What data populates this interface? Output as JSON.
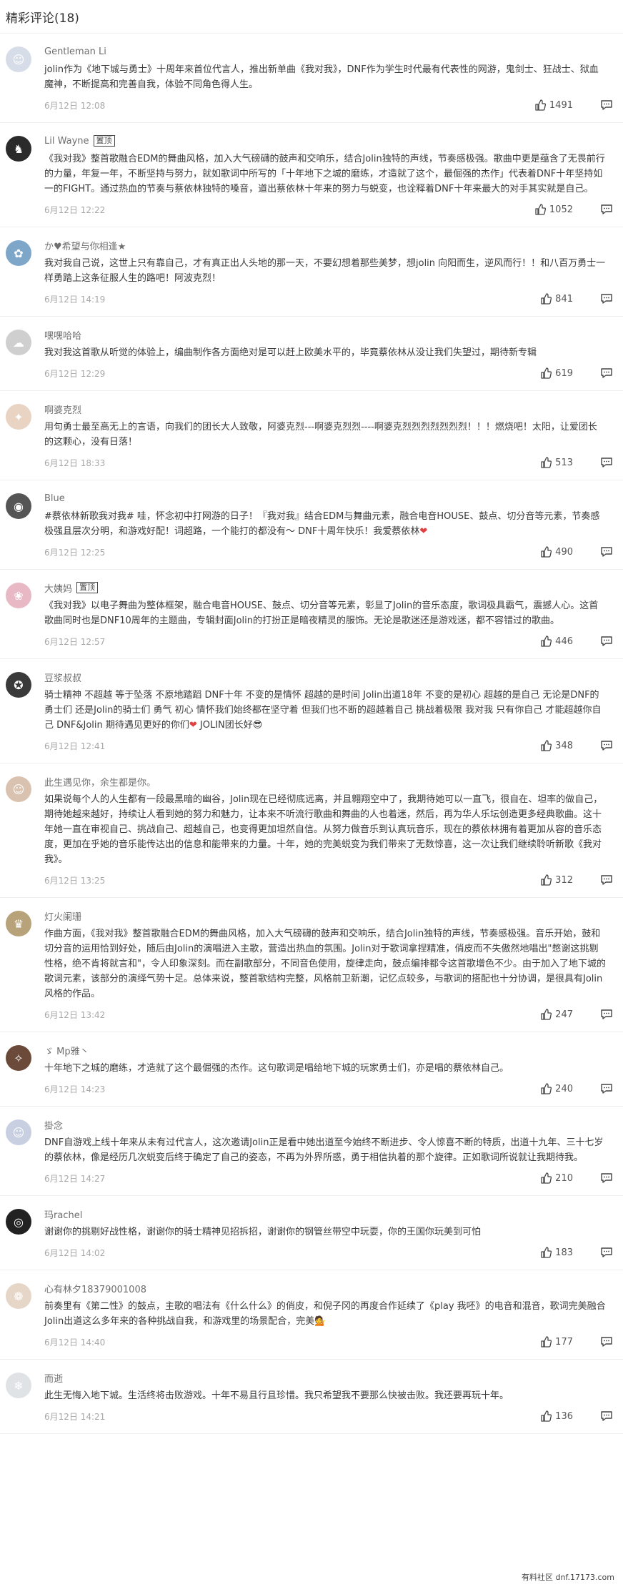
{
  "header": {
    "title": "精彩评论(18)"
  },
  "comments": [
    {
      "user": "Gentleman Li",
      "tag": "",
      "text": "jolin作为《地下城与勇士》十周年来首位代言人，推出新单曲《我对我》，DNF作为学生时代最有代表性的网游，鬼剑士、狂战士、狱血魔神，不断提高和完善自我，体验不同角色得人生。",
      "date": "6月12日 12:08",
      "likes": "1491",
      "avatar_color": "#d7dde8",
      "avatar_glyph": "☺"
    },
    {
      "user": "Lil Wayne",
      "tag": "置顶",
      "text": "《我对我》整首歌融合EDM的舞曲风格，加入大气磅礴的鼓声和交响乐，结合Jolin独特的声线，节奏感极强。歌曲中更是蕴含了无畏前行的力量，年复一年，不断坚持与努力，就如歌词中所写的「十年地下之城的磨练，才造就了这个，最倔强的杰作」代表着DNF十年坚持如一的FIGHT。通过热血的节奏与蔡依林独特的嗓音，道出蔡依林十年来的努力与蜕变，也诠释着DNF十年来最大的对手其实就是自己。",
      "date": "6月12日 12:22",
      "likes": "1052",
      "avatar_color": "#2b2b2b",
      "avatar_glyph": "♞"
    },
    {
      "user": "か♥希望与你相逢★",
      "tag": "",
      "text": "我对我自己说，这世上只有靠自己，才有真正出人头地的那一天，不要幻想着那些美梦，想jolin 向阳而生，逆风而行！！和八百万勇士一样勇踏上这条征服人生的路吧！阿波克烈！",
      "date": "6月12日 14:19",
      "likes": "841",
      "avatar_color": "#7da6c9",
      "avatar_glyph": "✿"
    },
    {
      "user": "嘿嘿哈哈",
      "tag": "",
      "text": "我对我这首歌从听觉的体验上，编曲制作各方面绝对是可以赶上欧美水平的，毕竟蔡依林从没让我们失望过，期待新专辑",
      "date": "6月12日 12:29",
      "likes": "619",
      "avatar_color": "#cfcfcf",
      "avatar_glyph": "☁"
    },
    {
      "user": "啊婆克烈",
      "tag": "",
      "text": "用句勇士最至高无上的言语，向我们的团长大人致敬，阿婆克烈---啊婆克烈烈----啊婆克烈烈烈烈烈烈烈！！！燃烧吧！太阳，让爱团长的这颗心，没有日落！",
      "date": "6月12日 18:33",
      "likes": "513",
      "avatar_color": "#e9d3c3",
      "avatar_glyph": "✦"
    },
    {
      "user": "Blue",
      "tag": "",
      "text": "#蔡依林新歌我对我# 哇，怀念初中打网游的日子！『我对我』结合EDM与舞曲元素，融合电音HOUSE、鼓点、切分音等元素，节奏感极强且层次分明，和游戏好配！词超路，一个能打的都没有～ DNF十周年快乐！我爱蔡依林",
      "date": "6月12日 12:25",
      "likes": "490",
      "avatar_color": "#555555",
      "avatar_glyph": "◉",
      "heart": true
    },
    {
      "user": "大姨妈",
      "tag": "置顶",
      "text": "《我对我》以电子舞曲为整体框架，融合电音HOUSE、鼓点、切分音等元素，彰显了Jolin的音乐态度，歌词极具霸气，震撼人心。这首歌曲同时也是DNF10周年的主题曲，专辑封面Jolin的打扮正是暗夜精灵的服饰。无论是歌迷还是游戏迷，都不容错过的歌曲。",
      "date": "6月12日 12:57",
      "likes": "446",
      "avatar_color": "#e8b8c4",
      "avatar_glyph": "❀"
    },
    {
      "user": "豆浆叔叔",
      "tag": "",
      "text": "骑士精神 不超越 等于坠落 不原地踏蹈 DNF十年 不变的是情怀 超越的是时间 Jolin出道18年 不变的是初心 超越的是自己 无论是DNF的勇士们 还是Jolin的骑士们 勇气 初心 情怀我们始终都在坚守着 但我们也不断的超越着自己 挑战着极限 我对我 只有你自己 才能超越你自己 DNF&Jolin 期待遇见更好的你们",
      "date": "6月12日 12:41",
      "likes": "348",
      "avatar_color": "#3a3a3a",
      "avatar_glyph": "✪",
      "heart": true,
      "suffix": " JOLIN团长好😎"
    },
    {
      "user": "此生遇见你，余生都是你。",
      "tag": "",
      "text": "如果说每个人的人生都有一段最黑暗的幽谷，Jolin现在已经彻底远离，并且翱翔空中了，我期待她可以一直飞，很自在、坦率的做自己，期待她越来越好，持续让人看到她的努力和魅力，让本来不听流行歌曲和舞曲的人也着迷，然后，再为华人乐坛创造更多经典歌曲。这十年她一直在审视自己、挑战自己、超越自己，也变得更加坦然自信。从努力做音乐到认真玩音乐，现在的蔡依林拥有着更加从容的音乐态度，更加在乎她的音乐能传达出的信息和能带来的力量。十年，她的完美蜕变为我们带来了无数惊喜，这一次让我们继续聆听新歌《我对我》。",
      "date": "6月12日 13:25",
      "likes": "312",
      "avatar_color": "#d9c2b0",
      "avatar_glyph": "☺"
    },
    {
      "user": "灯火阑珊",
      "tag": "",
      "text": "作曲方面，《我对我》整首歌融合EDM的舞曲风格，加入大气磅礴的鼓声和交响乐，结合Jolin独特的声线，节奏感极强。音乐开始，鼓和切分音的运用恰到好处，随后由Jolin的演唱进入主歌，营造出热血的氛围。Jolin对于歌词拿捏精准，俏皮而不失傲然地唱出\"憋谢这挑剔性格，绝不肯将就言和\"，令人印象深刻。而在副歌部分，不同音色使用，旋律走向，鼓点编排都令这首歌增色不少。由于加入了地下城的歌词元素，该部分的演绎气势十足。总体来说，整首歌结构完整，风格前卫新潮，记忆点较多，与歌词的搭配也十分协调，是很具有Jolin风格的作品。",
      "date": "6月12日 13:42",
      "likes": "247",
      "avatar_color": "#b8a27a",
      "avatar_glyph": "♛"
    },
    {
      "user": "ゞ Mp雅丶",
      "tag": "",
      "text": "十年地下之城的磨练，才造就了这个最倔强的杰作。这句歌词是唱给地下城的玩家勇士们，亦是唱的蔡依林自己。",
      "date": "6月12日 14:23",
      "likes": "240",
      "avatar_color": "#6b4a3a",
      "avatar_glyph": "✧"
    },
    {
      "user": "掛念",
      "tag": "",
      "text": "DNF自游戏上线十年来从未有过代言人，这次邀请Jolin正是看中她出道至今始终不断进步、令人惊喜不断的特质，出道十九年、三十七岁的蔡依林，像是经历几次蜕变后终于确定了自己的姿态，不再为外界所惑，勇于相信执着的那个旋律。正如歌词所说就让我期待我。",
      "date": "6月12日 14:27",
      "likes": "210",
      "avatar_color": "#c7cfe0",
      "avatar_glyph": "☺"
    },
    {
      "user": "玛rachel",
      "tag": "",
      "text": "谢谢你的挑剔好战性格，谢谢你的骑士精神见招拆招，谢谢你的钢管丝带空中玩耍，你的王国你玩美到可怕",
      "date": "6月12日 14:02",
      "likes": "183",
      "avatar_color": "#222222",
      "avatar_glyph": "◎"
    },
    {
      "user": "心有林夕18379001008",
      "tag": "",
      "text": "前奏里有《第二性》的鼓点，主歌的唱法有《什么什么》的俏皮，和倪子冈的再度合作延续了《play 我呸》的电音和混音，歌词完美融合Jolin出道这么多年来的各种挑战自我，和游戏里的场景配合，完美💁",
      "date": "6月12日 14:40",
      "likes": "177",
      "avatar_color": "#e6d6c8",
      "avatar_glyph": "❁"
    },
    {
      "user": "而逝",
      "tag": "",
      "text": "此生无悔入地下城。生活终将击败游戏。十年不易且行且珍惜。我只希望我不要那么快被击败。我还要再玩十年。",
      "date": "6月12日 14:21",
      "likes": "136",
      "avatar_color": "#dfe3e6",
      "avatar_glyph": "❄"
    }
  ],
  "watermark": "有料社区 dnf.17173.com"
}
